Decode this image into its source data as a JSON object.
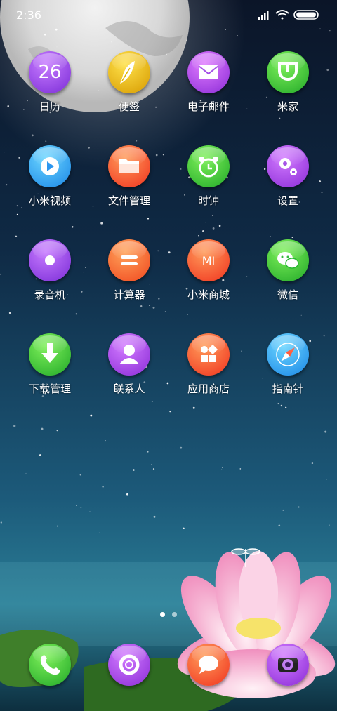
{
  "status_bar": {
    "time": "2:36"
  },
  "apps": [
    {
      "label": "日历",
      "icon": "calendar-icon",
      "date_text": "26",
      "color": [
        "#c77bff",
        "#7a2cd6"
      ]
    },
    {
      "label": "便签",
      "icon": "notes-icon",
      "color": [
        "#ffe14a",
        "#d69a00"
      ]
    },
    {
      "label": "电子邮件",
      "icon": "email-icon",
      "color": [
        "#e07cff",
        "#8a2bd6"
      ]
    },
    {
      "label": "米家",
      "icon": "mijia-icon",
      "color": [
        "#7ef05a",
        "#21a828"
      ]
    },
    {
      "label": "小米视频",
      "icon": "video-icon",
      "color": [
        "#6cd6ff",
        "#1a86e6"
      ]
    },
    {
      "label": "文件管理",
      "icon": "folder-icon",
      "color": [
        "#ff9b5a",
        "#f0321e"
      ]
    },
    {
      "label": "时钟",
      "icon": "clock-icon",
      "color": [
        "#7ef05a",
        "#21a828"
      ]
    },
    {
      "label": "设置",
      "icon": "gear-icon",
      "color": [
        "#d27bff",
        "#8a2bd6"
      ]
    },
    {
      "label": "录音机",
      "icon": "recorder-icon",
      "color": [
        "#c77bff",
        "#7a2cd6"
      ]
    },
    {
      "label": "计算器",
      "icon": "calculator-icon",
      "color": [
        "#ffa35a",
        "#f0461e"
      ]
    },
    {
      "label": "小米商城",
      "icon": "mi-store-icon",
      "mi_text": "MI",
      "color": [
        "#ff9b5a",
        "#f0321e"
      ]
    },
    {
      "label": "微信",
      "icon": "wechat-icon",
      "color": [
        "#7ef05a",
        "#21a828"
      ]
    },
    {
      "label": "下载管理",
      "icon": "download-icon",
      "color": [
        "#7ef05a",
        "#21a828"
      ]
    },
    {
      "label": "联系人",
      "icon": "contacts-icon",
      "color": [
        "#d27bff",
        "#8a2bd6"
      ]
    },
    {
      "label": "应用商店",
      "icon": "app-store-icon",
      "color": [
        "#ff9b5a",
        "#f0321e"
      ]
    },
    {
      "label": "指南针",
      "icon": "compass-icon",
      "color": [
        "#6cd6ff",
        "#1a86e6"
      ]
    }
  ],
  "dock": [
    {
      "icon": "phone-icon",
      "color": [
        "#7ef05a",
        "#21a828"
      ]
    },
    {
      "icon": "browser-icon",
      "color": [
        "#d27bff",
        "#8a2bd6"
      ]
    },
    {
      "icon": "messages-icon",
      "color": [
        "#ff9b5a",
        "#f0321e"
      ]
    },
    {
      "icon": "camera-icon",
      "color": [
        "#d27bff",
        "#8a2bd6"
      ]
    }
  ],
  "page_indicator": {
    "pages": 2,
    "current": 1
  }
}
